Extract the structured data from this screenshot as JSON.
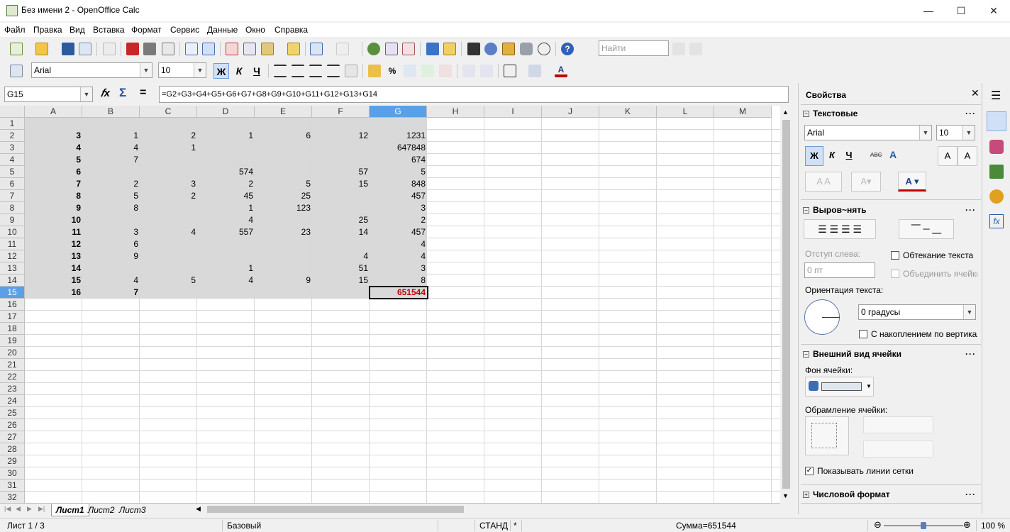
{
  "window": {
    "title": "Без имени 2 - OpenOffice Calc",
    "minimize": "—",
    "maximize": "☐",
    "close": "✕"
  },
  "menu": [
    "Файл",
    "Правка",
    "Вид",
    "Вставка",
    "Формат",
    "Сервис",
    "Данные",
    "Окно",
    "Справка"
  ],
  "toolbar": {
    "find_placeholder": "Найти"
  },
  "format_toolbar": {
    "font": "Arial",
    "size": "10",
    "bold": "Ж",
    "italic": "К",
    "underline": "Ч"
  },
  "formula_bar": {
    "name_box": "G15",
    "fx": "𝑓x",
    "sum": "Σ",
    "equals": "=",
    "formula": "=G2+G3+G4+G5+G6+G7+G8+G9+G10+G11+G12+G13+G14"
  },
  "grid": {
    "columns": [
      "A",
      "B",
      "C",
      "D",
      "E",
      "F",
      "G",
      "H",
      "I",
      "J",
      "K",
      "L",
      "M"
    ],
    "active_column": "G",
    "active_row": 15,
    "rows": [
      {
        "A": "",
        "B": "",
        "C": "",
        "D": "",
        "E": "",
        "F": "",
        "G": ""
      },
      {
        "A": "3",
        "B": "1",
        "C": "2",
        "D": "1",
        "E": "6",
        "F": "12",
        "G": "1231"
      },
      {
        "A": "4",
        "B": "4",
        "C": "1",
        "D": "",
        "E": "",
        "F": "",
        "G": "647848"
      },
      {
        "A": "5",
        "B": "7",
        "C": "",
        "D": "",
        "E": "",
        "F": "",
        "G": "674"
      },
      {
        "A": "6",
        "B": "",
        "C": "",
        "D": "574",
        "E": "",
        "F": "57",
        "G": "5"
      },
      {
        "A": "7",
        "B": "2",
        "C": "3",
        "D": "2",
        "E": "5",
        "F": "15",
        "G": "848"
      },
      {
        "A": "8",
        "B": "5",
        "C": "2",
        "D": "45",
        "E": "25",
        "F": "",
        "G": "457"
      },
      {
        "A": "9",
        "B": "8",
        "C": "",
        "D": "1",
        "E": "123",
        "F": "",
        "G": "3"
      },
      {
        "A": "10",
        "B": "",
        "C": "",
        "D": "4",
        "E": "",
        "F": "25",
        "G": "2"
      },
      {
        "A": "11",
        "B": "3",
        "C": "4",
        "D": "557",
        "E": "23",
        "F": "14",
        "G": "457"
      },
      {
        "A": "12",
        "B": "6",
        "C": "",
        "D": "",
        "E": "",
        "F": "",
        "G": "4"
      },
      {
        "A": "13",
        "B": "9",
        "C": "",
        "D": "",
        "E": "",
        "F": "4",
        "G": "4"
      },
      {
        "A": "14",
        "B": "",
        "C": "",
        "D": "1",
        "E": "",
        "F": "51",
        "G": "3"
      },
      {
        "A": "15",
        "B": "4",
        "C": "5",
        "D": "4",
        "E": "9",
        "F": "15",
        "G": "8"
      },
      {
        "A": "16",
        "B": "7",
        "C": "",
        "D": "",
        "E": "",
        "F": "",
        "G": "651544"
      }
    ],
    "row_count": 32
  },
  "sheets": {
    "tabs": [
      "Лист1",
      "Лист2",
      "Лист3"
    ],
    "active": "Лист1"
  },
  "status": {
    "sheet": "Лист 1 / 3",
    "style": "Базовый",
    "mode": "СТАНД",
    "modified": "*",
    "sum": "Сумма=651544",
    "zoom": "100 %",
    "zoom_level": 1.0
  },
  "sidebar": {
    "title": "Свойства",
    "text_section": {
      "title": "Текстовые",
      "font": "Arial",
      "size": "10"
    },
    "align_section": {
      "title": "Выров~нять",
      "indent_label": "Отступ слева:",
      "indent_value": "0 пт",
      "wrap_label": "Обтекание текста",
      "merge_label": "Объединить ячейки",
      "orientation_label": "Ориентация текста:",
      "orientation_value": "0 градусы",
      "stacked_label": "С накоплением по вертикали"
    },
    "cell_section": {
      "title": "Внешний вид ячейки",
      "bg_label": "Фон ячейки:",
      "border_label": "Обрамление ячейки:",
      "gridlines_label": "Показывать линии сетки"
    },
    "number_section": {
      "title": "Числовой формат"
    }
  }
}
